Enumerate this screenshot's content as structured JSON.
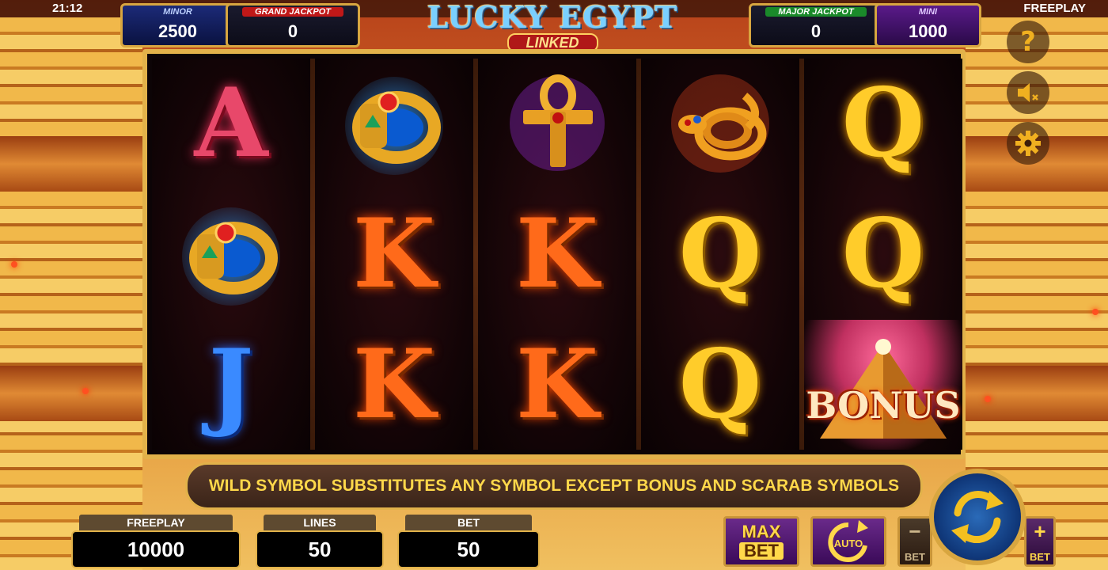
{
  "status_bar": {
    "time": "21:12",
    "mode": "FREEPLAY"
  },
  "logo": {
    "title": "LUCKY EGYPT",
    "subtitle": "LINKED"
  },
  "jackpots": {
    "minor": {
      "label": "MINOR",
      "value": "2500"
    },
    "grand": {
      "label": "GRAND JACKPOT",
      "value": "0"
    },
    "major": {
      "label": "MAJOR JACKPOT",
      "value": "0"
    },
    "mini": {
      "label": "MINI",
      "value": "1000"
    }
  },
  "reels": [
    [
      "A",
      "ring",
      "J"
    ],
    [
      "ring",
      "K",
      "K"
    ],
    [
      "ankh",
      "K",
      "K"
    ],
    [
      "snake",
      "Q",
      "Q"
    ],
    [
      "Q",
      "Q",
      "bonus"
    ]
  ],
  "bonus_symbol_text": "BONUS",
  "info_banner": "WILD SYMBOL SUBSTITUTES ANY SYMBOL EXCEPT BONUS AND SCARAB SYMBOLS",
  "stats": {
    "freeplay": {
      "label": "FREEPLAY",
      "value": "10000"
    },
    "lines": {
      "label": "LINES",
      "value": "50"
    },
    "bet": {
      "label": "BET",
      "value": "50"
    }
  },
  "buttons": {
    "max_bet_line1": "MAX",
    "max_bet_line2": "BET",
    "auto": "AUTO",
    "bet_minus_sign": "−",
    "bet_minus_label": "BET",
    "bet_plus_sign": "+",
    "bet_plus_label": "BET"
  },
  "side_icons": [
    "help-icon",
    "sound-muted-icon",
    "settings-gear-icon"
  ],
  "colors": {
    "gold": "#e2b24a",
    "banner_text": "#ffd84a",
    "spin_blue": "#2a6ab8"
  }
}
